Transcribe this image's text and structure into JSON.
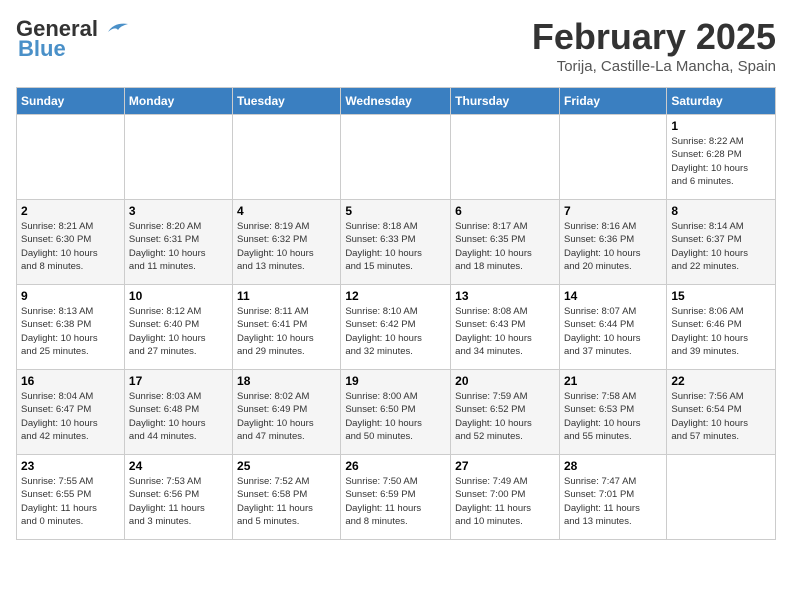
{
  "header": {
    "logo_line1": "General",
    "logo_line2": "Blue",
    "month_year": "February 2025",
    "location": "Torija, Castille-La Mancha, Spain"
  },
  "days_of_week": [
    "Sunday",
    "Monday",
    "Tuesday",
    "Wednesday",
    "Thursday",
    "Friday",
    "Saturday"
  ],
  "weeks": [
    [
      {
        "day": "",
        "info": ""
      },
      {
        "day": "",
        "info": ""
      },
      {
        "day": "",
        "info": ""
      },
      {
        "day": "",
        "info": ""
      },
      {
        "day": "",
        "info": ""
      },
      {
        "day": "",
        "info": ""
      },
      {
        "day": "1",
        "info": "Sunrise: 8:22 AM\nSunset: 6:28 PM\nDaylight: 10 hours\nand 6 minutes."
      }
    ],
    [
      {
        "day": "2",
        "info": "Sunrise: 8:21 AM\nSunset: 6:30 PM\nDaylight: 10 hours\nand 8 minutes."
      },
      {
        "day": "3",
        "info": "Sunrise: 8:20 AM\nSunset: 6:31 PM\nDaylight: 10 hours\nand 11 minutes."
      },
      {
        "day": "4",
        "info": "Sunrise: 8:19 AM\nSunset: 6:32 PM\nDaylight: 10 hours\nand 13 minutes."
      },
      {
        "day": "5",
        "info": "Sunrise: 8:18 AM\nSunset: 6:33 PM\nDaylight: 10 hours\nand 15 minutes."
      },
      {
        "day": "6",
        "info": "Sunrise: 8:17 AM\nSunset: 6:35 PM\nDaylight: 10 hours\nand 18 minutes."
      },
      {
        "day": "7",
        "info": "Sunrise: 8:16 AM\nSunset: 6:36 PM\nDaylight: 10 hours\nand 20 minutes."
      },
      {
        "day": "8",
        "info": "Sunrise: 8:14 AM\nSunset: 6:37 PM\nDaylight: 10 hours\nand 22 minutes."
      }
    ],
    [
      {
        "day": "9",
        "info": "Sunrise: 8:13 AM\nSunset: 6:38 PM\nDaylight: 10 hours\nand 25 minutes."
      },
      {
        "day": "10",
        "info": "Sunrise: 8:12 AM\nSunset: 6:40 PM\nDaylight: 10 hours\nand 27 minutes."
      },
      {
        "day": "11",
        "info": "Sunrise: 8:11 AM\nSunset: 6:41 PM\nDaylight: 10 hours\nand 29 minutes."
      },
      {
        "day": "12",
        "info": "Sunrise: 8:10 AM\nSunset: 6:42 PM\nDaylight: 10 hours\nand 32 minutes."
      },
      {
        "day": "13",
        "info": "Sunrise: 8:08 AM\nSunset: 6:43 PM\nDaylight: 10 hours\nand 34 minutes."
      },
      {
        "day": "14",
        "info": "Sunrise: 8:07 AM\nSunset: 6:44 PM\nDaylight: 10 hours\nand 37 minutes."
      },
      {
        "day": "15",
        "info": "Sunrise: 8:06 AM\nSunset: 6:46 PM\nDaylight: 10 hours\nand 39 minutes."
      }
    ],
    [
      {
        "day": "16",
        "info": "Sunrise: 8:04 AM\nSunset: 6:47 PM\nDaylight: 10 hours\nand 42 minutes."
      },
      {
        "day": "17",
        "info": "Sunrise: 8:03 AM\nSunset: 6:48 PM\nDaylight: 10 hours\nand 44 minutes."
      },
      {
        "day": "18",
        "info": "Sunrise: 8:02 AM\nSunset: 6:49 PM\nDaylight: 10 hours\nand 47 minutes."
      },
      {
        "day": "19",
        "info": "Sunrise: 8:00 AM\nSunset: 6:50 PM\nDaylight: 10 hours\nand 50 minutes."
      },
      {
        "day": "20",
        "info": "Sunrise: 7:59 AM\nSunset: 6:52 PM\nDaylight: 10 hours\nand 52 minutes."
      },
      {
        "day": "21",
        "info": "Sunrise: 7:58 AM\nSunset: 6:53 PM\nDaylight: 10 hours\nand 55 minutes."
      },
      {
        "day": "22",
        "info": "Sunrise: 7:56 AM\nSunset: 6:54 PM\nDaylight: 10 hours\nand 57 minutes."
      }
    ],
    [
      {
        "day": "23",
        "info": "Sunrise: 7:55 AM\nSunset: 6:55 PM\nDaylight: 11 hours\nand 0 minutes."
      },
      {
        "day": "24",
        "info": "Sunrise: 7:53 AM\nSunset: 6:56 PM\nDaylight: 11 hours\nand 3 minutes."
      },
      {
        "day": "25",
        "info": "Sunrise: 7:52 AM\nSunset: 6:58 PM\nDaylight: 11 hours\nand 5 minutes."
      },
      {
        "day": "26",
        "info": "Sunrise: 7:50 AM\nSunset: 6:59 PM\nDaylight: 11 hours\nand 8 minutes."
      },
      {
        "day": "27",
        "info": "Sunrise: 7:49 AM\nSunset: 7:00 PM\nDaylight: 11 hours\nand 10 minutes."
      },
      {
        "day": "28",
        "info": "Sunrise: 7:47 AM\nSunset: 7:01 PM\nDaylight: 11 hours\nand 13 minutes."
      },
      {
        "day": "",
        "info": ""
      }
    ]
  ]
}
